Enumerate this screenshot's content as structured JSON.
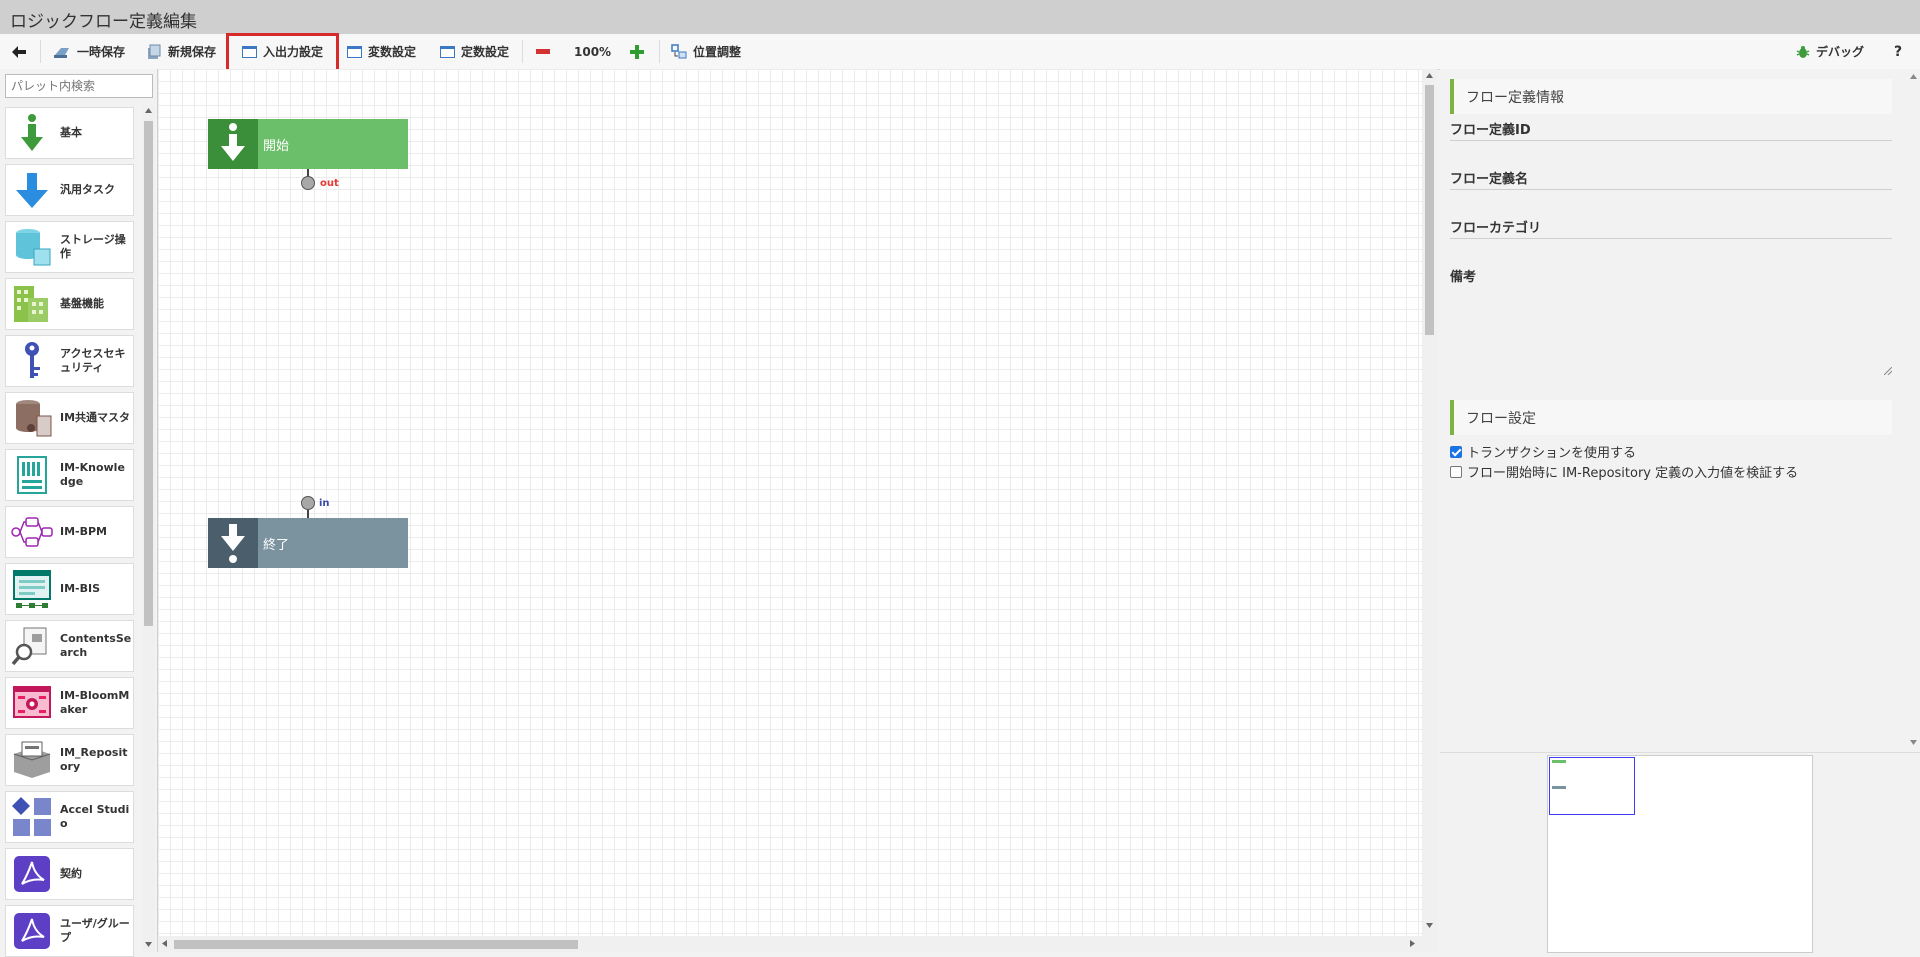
{
  "window": {
    "title": "ロジックフロー定義編集"
  },
  "toolbar": {
    "temp_save": "一時保存",
    "new_save": "新規保存",
    "io_settings": "入出力設定",
    "var_settings": "変数設定",
    "const_settings": "定数設定",
    "zoom": "100%",
    "position_adjust": "位置調整",
    "debug": "デバッグ",
    "help": "?"
  },
  "palette": {
    "search_placeholder": "パレット内検索",
    "items": [
      {
        "label": "基本",
        "icon": "down-arrow-green-icon"
      },
      {
        "label": "汎用タスク",
        "icon": "down-arrow-blue-icon"
      },
      {
        "label": "ストレージ操作",
        "icon": "storage-icon"
      },
      {
        "label": "基盤機能",
        "icon": "building-icon"
      },
      {
        "label": "アクセスセキュリティ",
        "icon": "key-icon"
      },
      {
        "label": "IM共通マスタ",
        "icon": "database-user-icon"
      },
      {
        "label": "IM-Knowledge",
        "icon": "book-icon"
      },
      {
        "label": "IM-BPM",
        "icon": "process-icon"
      },
      {
        "label": "IM-BIS",
        "icon": "form-icon"
      },
      {
        "label": "ContentsSearch",
        "icon": "search-document-icon"
      },
      {
        "label": "IM-BloomMaker",
        "icon": "bloommaker-icon"
      },
      {
        "label": "IM_Repository",
        "icon": "repository-icon"
      },
      {
        "label": "Accel Studio",
        "icon": "accel-studio-icon"
      },
      {
        "label": "契約",
        "icon": "pdf-icon"
      },
      {
        "label": "ユーザ/グループ",
        "icon": "pdf-icon"
      }
    ]
  },
  "canvas": {
    "start_node": {
      "label": "開始",
      "port": "out"
    },
    "end_node": {
      "label": "終了",
      "port": "in"
    }
  },
  "properties": {
    "flow_info_header": "フロー定義情報",
    "flow_id_label": "フロー定義ID",
    "flow_name_label": "フロー定義名",
    "flow_category_label": "フローカテゴリ",
    "remarks_label": "備考",
    "flow_settings_header": "フロー設定",
    "use_transaction": {
      "label": "トランザクションを使用する",
      "checked": true
    },
    "validate_input": {
      "label": "フロー開始時に IM-Repository 定義の入力値を検証する",
      "checked": false
    }
  },
  "colors": {
    "start_node": "#6cbf6a",
    "start_node_icon_bg": "#3b8f3a",
    "end_node": "#7b929f",
    "end_node_icon_bg": "#4a5e6b",
    "highlight": "#d72a2a",
    "accent": "#7cb342"
  }
}
